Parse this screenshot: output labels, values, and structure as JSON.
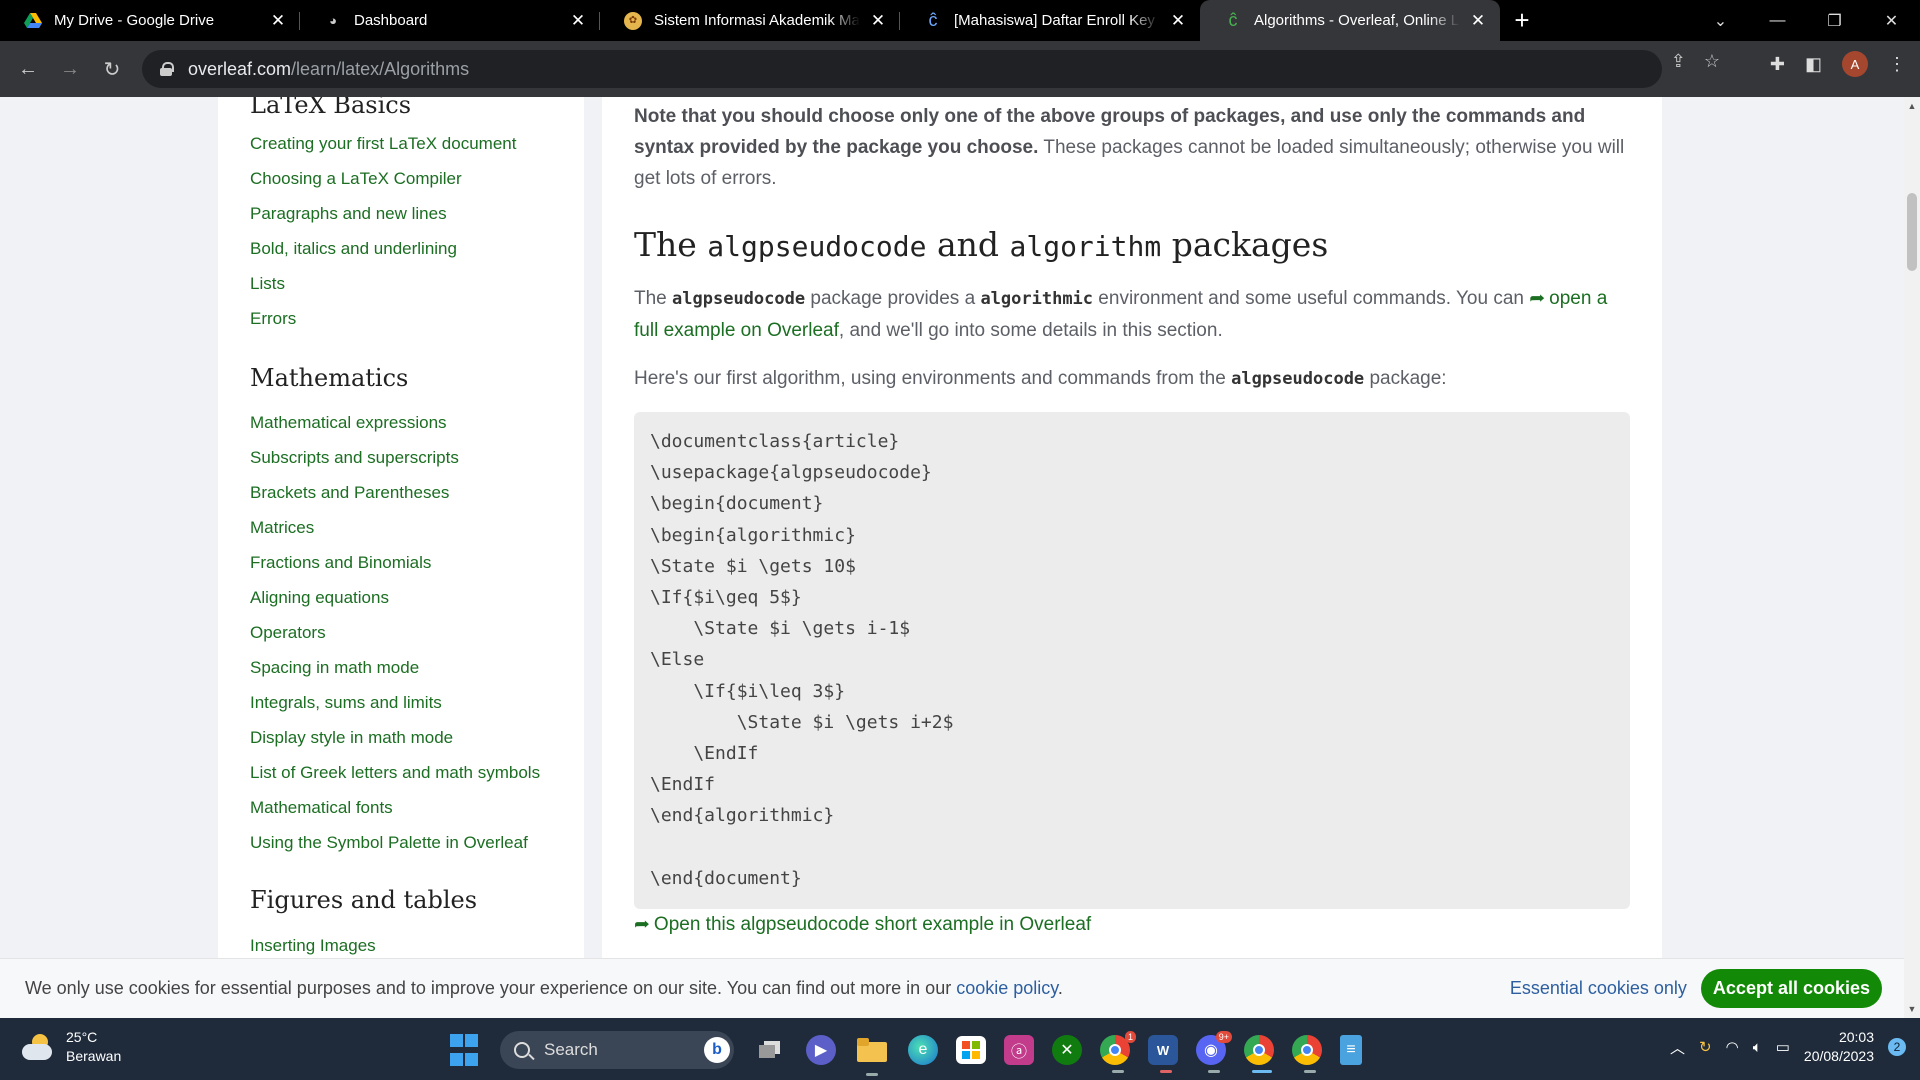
{
  "browser": {
    "tabs": [
      {
        "title": "My Drive - Google Drive",
        "icon": "google-drive-icon"
      },
      {
        "title": "Dashboard",
        "icon": "dashboard-icon"
      },
      {
        "title": "Sistem Informasi Akademik Mahasiswa",
        "icon": "university-icon"
      },
      {
        "title": "[Mahasiswa] Daftar Enroll Key BRONE",
        "icon": "leaf-icon"
      },
      {
        "title": "Algorithms - Overleaf, Online LaTeX",
        "icon": "overleaf-icon"
      }
    ],
    "url_host": "overleaf.com",
    "url_path": "/learn/latex/Algorithms",
    "profile_initial": "A"
  },
  "sidebar": {
    "partial_heading": "LaTeX Basics",
    "basics": [
      "Creating your first LaTeX document",
      "Choosing a LaTeX Compiler",
      "Paragraphs and new lines",
      "Bold, italics and underlining",
      "Lists",
      "Errors"
    ],
    "math_heading": "Mathematics",
    "math": [
      "Mathematical expressions",
      "Subscripts and superscripts",
      "Brackets and Parentheses",
      "Matrices",
      "Fractions and Binomials",
      "Aligning equations",
      "Operators",
      "Spacing in math mode",
      "Integrals, sums and limits",
      "Display style in math mode",
      "List of Greek letters and math symbols",
      "Mathematical fonts",
      "Using the Symbol Palette in Overleaf"
    ],
    "figures_heading": "Figures and tables",
    "figures": [
      "Inserting Images"
    ]
  },
  "main": {
    "note_bold": "Note that you should choose only one of the above groups of packages, and use only the commands and syntax provided by the package you choose.",
    "note_rest": " These packages cannot be loaded simultaneously; otherwise you will get lots of errors.",
    "heading_pre": "The ",
    "heading_code1": "algpseudocode",
    "heading_mid": " and ",
    "heading_code2": "algorithm",
    "heading_post": " packages",
    "p1_a": "The ",
    "p1_code1": "algpseudocode",
    "p1_b": " package provides a ",
    "p1_code2": "algorithmic",
    "p1_c": " environment and some useful commands. You can ",
    "p1_link": "open a full example on Overleaf",
    "p1_d": ", and we'll go into some details in this section.",
    "p2_a": "Here's our first algorithm, using environments and commands from the ",
    "p2_code": "algpseudocode",
    "p2_b": " package:",
    "code": "\\documentclass{article}\n\\usepackage{algpseudocode}\n\\begin{document}\n\\begin{algorithmic}\n\\State $i \\gets 10$\n\\If{$i\\geq 5$}\n    \\State $i \\gets i-1$\n\\Else\n    \\If{$i\\leq 3$}\n        \\State $i \\gets i+2$\n    \\EndIf\n\\EndIf\n\\end{algorithmic}\n\n\\end{document}",
    "open_example_link": "Open this algpseudocode short example in Overleaf"
  },
  "cookie": {
    "message": "We only use cookies for essential purposes and to improve your experience on our site. You can find out more in our ",
    "policy_link": "cookie policy",
    "period": ".",
    "essential_label": "Essential cookies only",
    "accept_label": "Accept all cookies"
  },
  "taskbar": {
    "temperature": "25°C",
    "weather": "Berawan",
    "search_placeholder": "Search",
    "time": "20:03",
    "date": "20/08/2023",
    "notification_count": "2",
    "discord_badge": "9+",
    "chrome_badge": "1"
  },
  "colors": {
    "link": "#1b6e22",
    "accept": "#138a07",
    "cookie_link": "#2d5fa0"
  }
}
